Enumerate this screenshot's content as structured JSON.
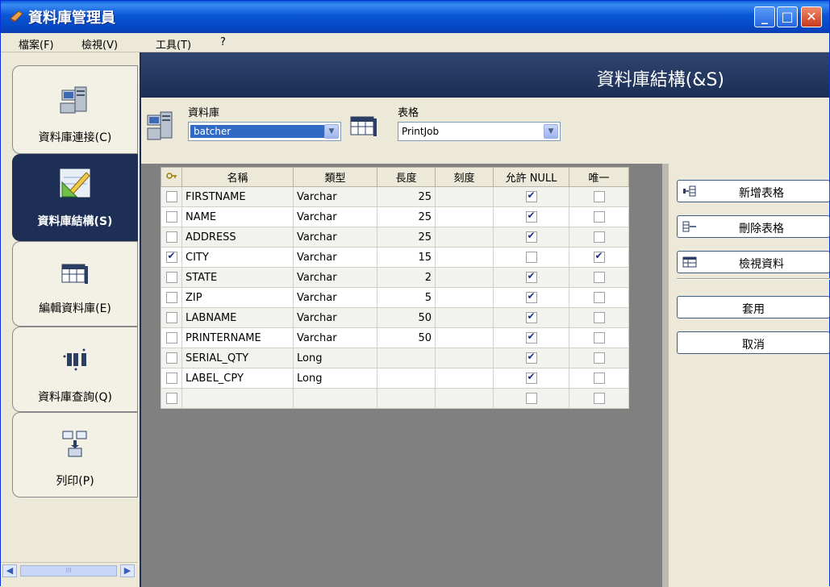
{
  "window": {
    "title": "資料庫管理員"
  },
  "menu": [
    "檔案(F)",
    "檢視(V)",
    "工具(T)",
    "?"
  ],
  "nav": [
    {
      "label": "資料庫連接(C)",
      "icon": "server-icon",
      "active": false
    },
    {
      "label": "資料庫結構(S)",
      "icon": "design-icon",
      "active": true
    },
    {
      "label": "編輯資料庫(E)",
      "icon": "table-icon",
      "active": false
    },
    {
      "label": "資料庫查詢(Q)",
      "icon": "query-icon",
      "active": false
    },
    {
      "label": "列印(P)",
      "icon": "print-icon",
      "active": false
    }
  ],
  "panel": {
    "title": "資料庫結構(&S)"
  },
  "database": {
    "label": "資料庫",
    "value": "batcher"
  },
  "table": {
    "label": "表格",
    "value": "PrintJob"
  },
  "grid": {
    "headers": [
      "名稱",
      "類型",
      "長度",
      "刻度",
      "允許 NULL",
      "唯一"
    ],
    "rows": [
      {
        "key": false,
        "name": "FIRSTNAME",
        "type": "Varchar",
        "length": "25",
        "scale": "",
        "allow_null": true,
        "unique": false
      },
      {
        "key": false,
        "name": "NAME",
        "type": "Varchar",
        "length": "25",
        "scale": "",
        "allow_null": true,
        "unique": false
      },
      {
        "key": false,
        "name": "ADDRESS",
        "type": "Varchar",
        "length": "25",
        "scale": "",
        "allow_null": true,
        "unique": false
      },
      {
        "key": true,
        "name": "CITY",
        "type": "Varchar",
        "length": "15",
        "scale": "",
        "allow_null": false,
        "unique": true
      },
      {
        "key": false,
        "name": "STATE",
        "type": "Varchar",
        "length": "2",
        "scale": "",
        "allow_null": true,
        "unique": false
      },
      {
        "key": false,
        "name": "ZIP",
        "type": "Varchar",
        "length": "5",
        "scale": "",
        "allow_null": true,
        "unique": false
      },
      {
        "key": false,
        "name": "LABNAME",
        "type": "Varchar",
        "length": "50",
        "scale": "",
        "allow_null": true,
        "unique": false
      },
      {
        "key": false,
        "name": "PRINTERNAME",
        "type": "Varchar",
        "length": "50",
        "scale": "",
        "allow_null": true,
        "unique": false
      },
      {
        "key": false,
        "name": "SERIAL_QTY",
        "type": "Long",
        "length": "",
        "scale": "",
        "allow_null": true,
        "unique": false
      },
      {
        "key": false,
        "name": "LABEL_CPY",
        "type": "Long",
        "length": "",
        "scale": "",
        "allow_null": true,
        "unique": false
      },
      {
        "key": false,
        "name": "",
        "type": "",
        "length": "",
        "scale": "",
        "allow_null": false,
        "unique": false
      }
    ]
  },
  "actions": {
    "add_table": "新增表格",
    "delete_table": "刪除表格",
    "view_data": "檢視資料",
    "apply": "套用",
    "cancel": "取消"
  },
  "scrollbar": {
    "thumb_text": "III"
  },
  "colors": {
    "nav_active": "#1d2f55",
    "titlebar": "#0a56d5",
    "selection": "#316ac5"
  }
}
